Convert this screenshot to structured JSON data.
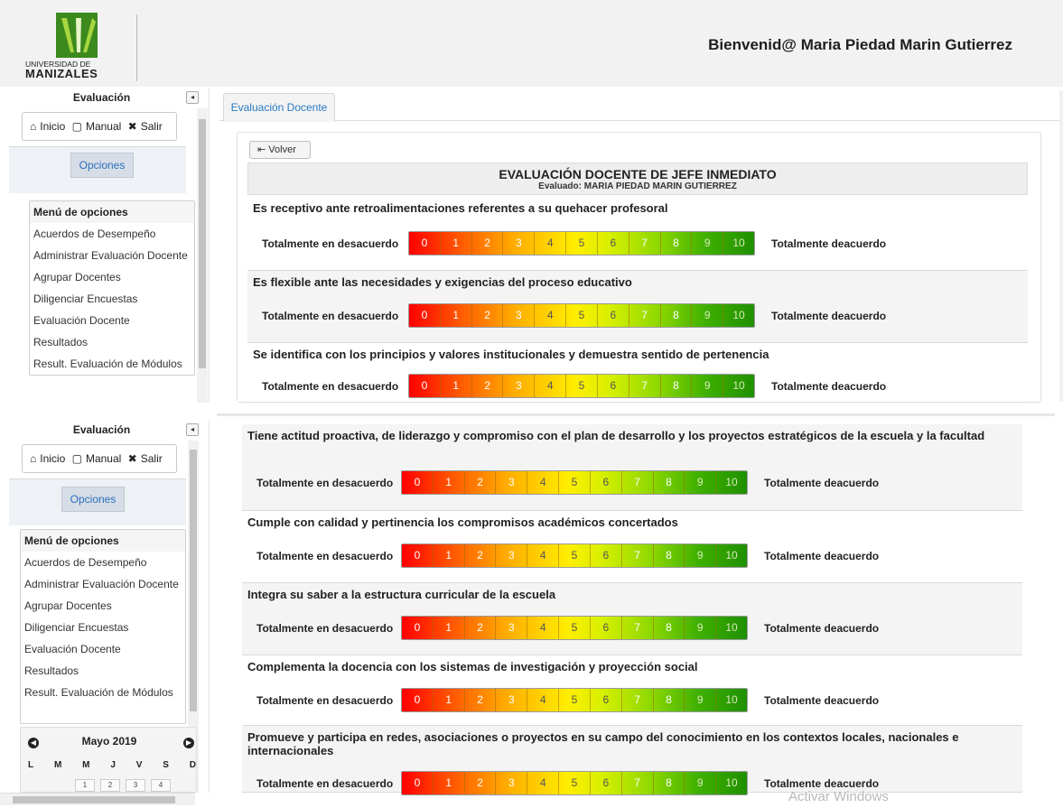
{
  "header": {
    "logo_line1": "UNIVERSIDAD DE",
    "logo_line2": "MANIZALES",
    "welcome": "Bienvenid@ Maria Piedad Marin Gutierrez"
  },
  "sidebar": {
    "title": "Evaluación",
    "collapse_glyph": "◂",
    "toolbar": {
      "home": "Inicio",
      "manual": "Manual",
      "exit": "Salir"
    },
    "options_button": "Opciones",
    "menu_header": "Menú de opciones",
    "menu_items": [
      "Acuerdos de Desempeño",
      "Administrar Evaluación Docente",
      "Agrupar Docentes",
      "Diligenciar Encuestas",
      "Evaluación Docente",
      "Resultados",
      "Result. Evaluación de Módulos"
    ]
  },
  "calendar": {
    "month": "Mayo 2019",
    "days": [
      "L",
      "M",
      "M",
      "J",
      "V",
      "S",
      "D"
    ],
    "dates": [
      "1",
      "2",
      "3",
      "4"
    ]
  },
  "main": {
    "tab": "Evaluación Docente",
    "back_button": "Volver",
    "title": "EVALUACIÓN DOCENTE DE JEFE INMEDIATO",
    "subtitle": "Evaluado: MARIA PIEDAD MARIN GUTIERREZ",
    "scale_left": "Totalmente en desacuerdo",
    "scale_right": "Totalmente deacuerdo",
    "scale_values": [
      "0",
      "1",
      "2",
      "3",
      "4",
      "5",
      "6",
      "7",
      "8",
      "9",
      "10"
    ],
    "questions_top": [
      "Es receptivo ante retroalimentaciones referentes a su quehacer profesoral",
      "Es flexible ante las necesidades y exigencias del proceso educativo",
      "Se identifica con los principios y valores institucionales y demuestra sentido de pertenencia"
    ],
    "questions_bottom": [
      "Tiene actitud proactiva, de liderazgo y compromiso con el plan de desarrollo y los proyectos estratégicos de la escuela y la facultad",
      "Cumple con calidad y pertinencia los compromisos académicos concertados",
      "Integra su saber a la estructura curricular de la escuela",
      "Complementa la docencia con los sistemas de investigación y proyección social",
      "Promueve y participa en redes, asociaciones o proyectos en su campo del conocimiento en los contextos locales, nacionales e internacionales"
    ]
  },
  "watermark": "Activar Windows"
}
